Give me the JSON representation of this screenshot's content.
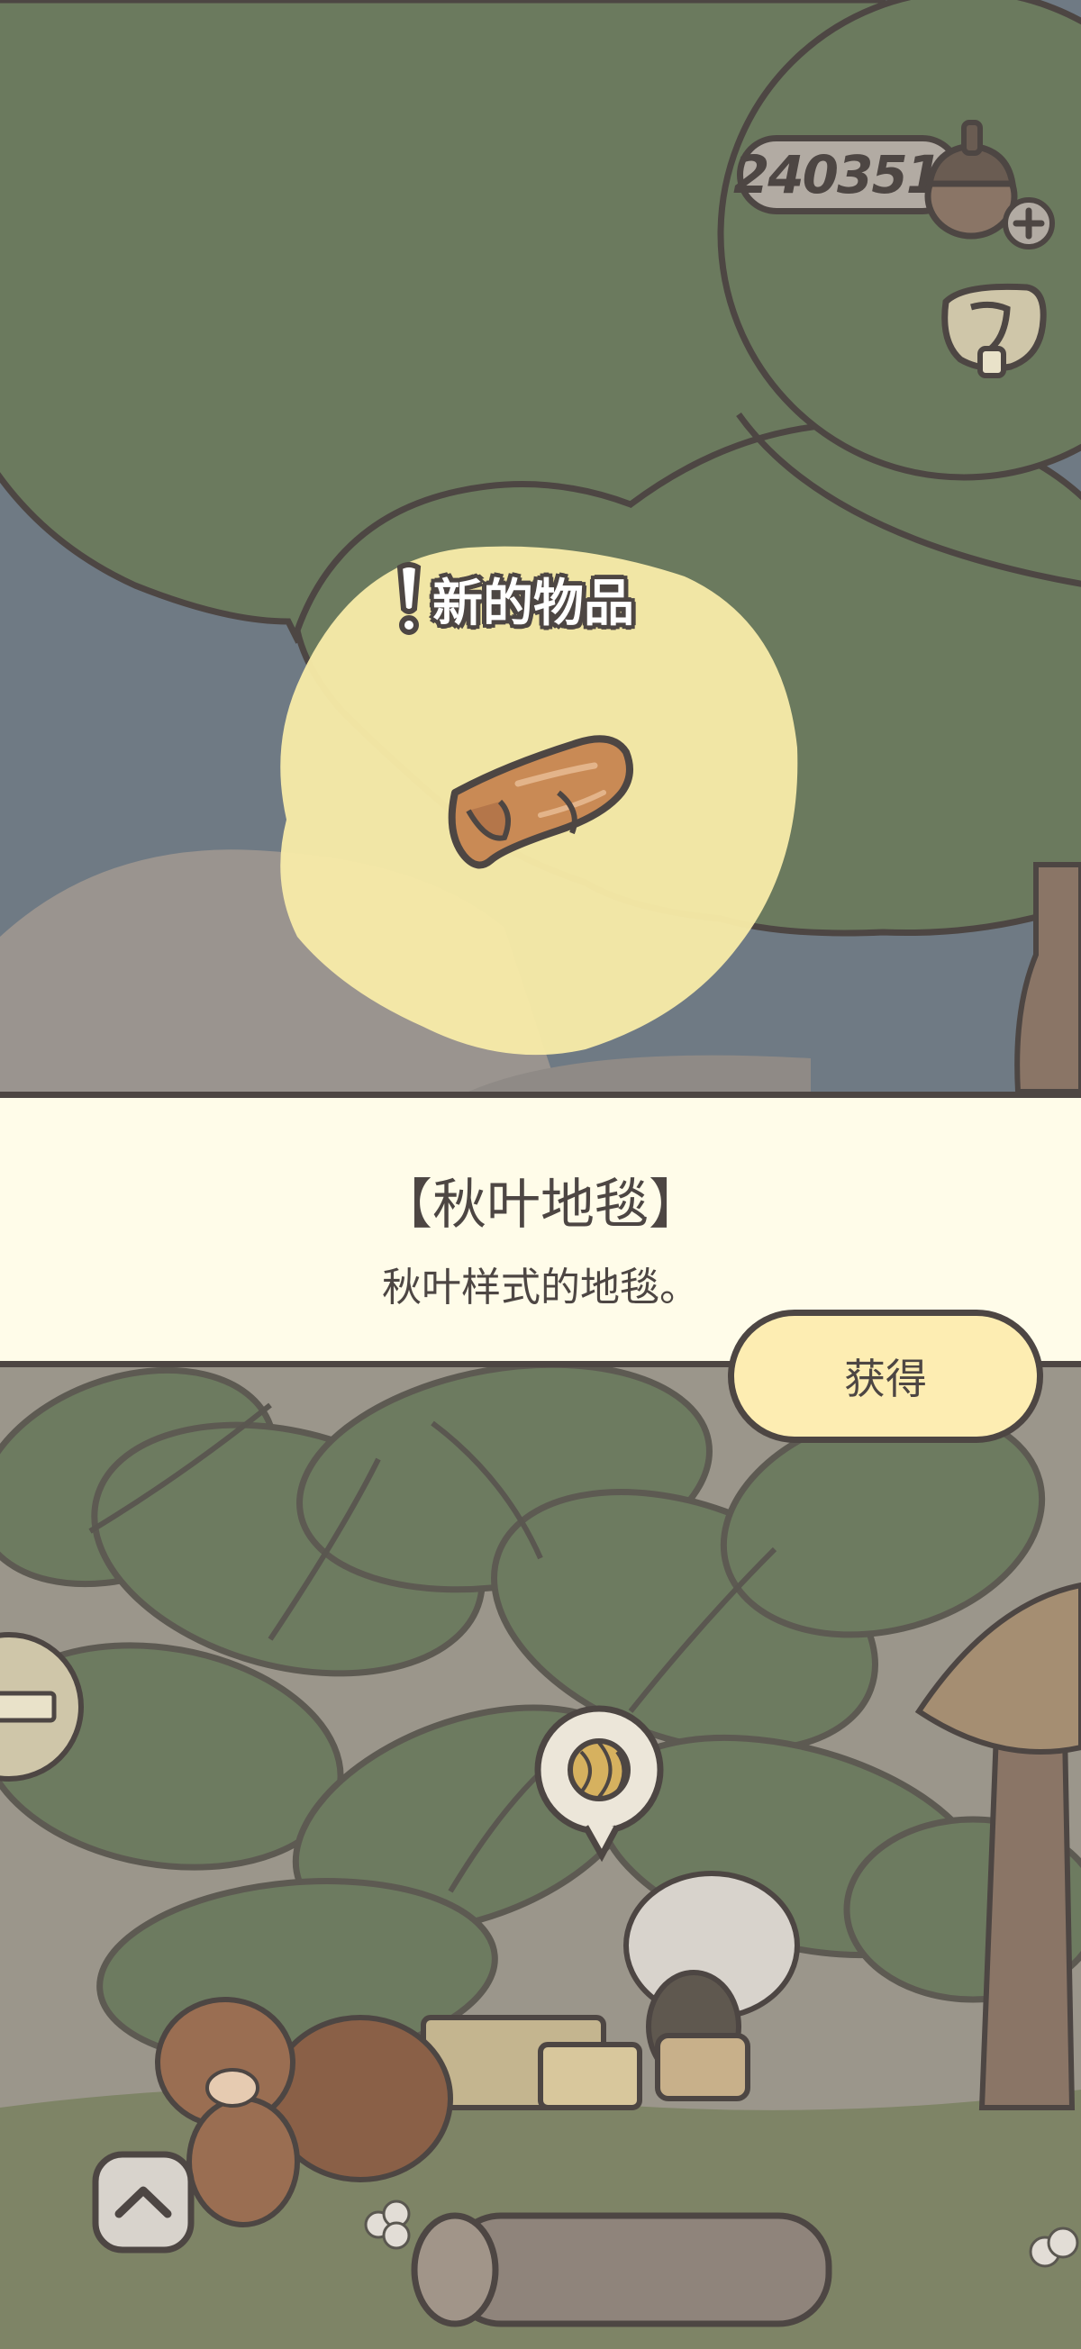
{
  "currency": {
    "amount": "240351",
    "icon": "acorn-icon",
    "add_icon": "plus-icon"
  },
  "top_right": {
    "icon": "gift-wrap-icon"
  },
  "new_item_banner": {
    "label": "新的物品",
    "icon": "exclamation-icon"
  },
  "item": {
    "title": "【秋叶地毯】",
    "description": "秋叶样式的地毯。",
    "icon": "rolled-rug-icon",
    "obtain_label": "获得"
  },
  "scene": {
    "speech_bubble_icon": "yarn-ball-icon",
    "left_bubble_icon": "cabinet-icon",
    "expand_icon": "chevron-up-icon"
  },
  "colors": {
    "outline": "#4d4643",
    "band_bg": "#fffce9",
    "button_bg": "#fdedb2",
    "highlight": "#f7eaa8",
    "tree_green": "#6b7a5e"
  }
}
